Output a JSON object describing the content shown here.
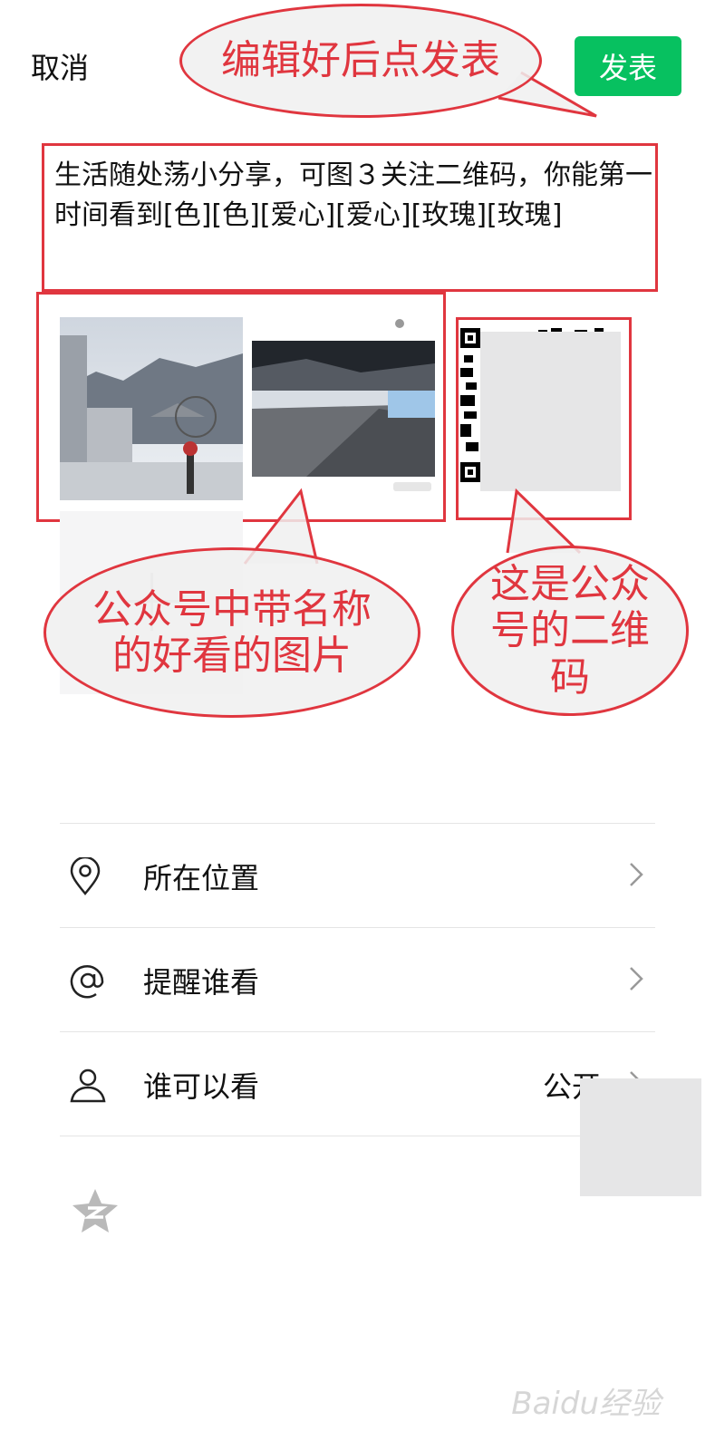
{
  "header": {
    "cancel_label": "取消",
    "publish_label": "发表"
  },
  "post": {
    "text": "生活随处荡小分享，可图３关注二维码，你能第一时间看到[色][色][爱心][爱心][玫瑰][玫瑰]"
  },
  "annotations": {
    "top_bubble": "编辑好后点发表",
    "left_bubble": "公众号中带名称的好看的图片",
    "right_bubble": "这是公众号的二维码"
  },
  "settings": [
    {
      "icon": "location-pin-icon",
      "label": "所在位置",
      "value": ""
    },
    {
      "icon": "at-sign-icon",
      "label": "提醒谁看",
      "value": ""
    },
    {
      "icon": "person-icon",
      "label": "谁可以看",
      "value": "公开"
    }
  ],
  "colors": {
    "publish_green": "#07c160",
    "annotation_red": "#e0363f"
  },
  "watermark": "Baidu经验"
}
